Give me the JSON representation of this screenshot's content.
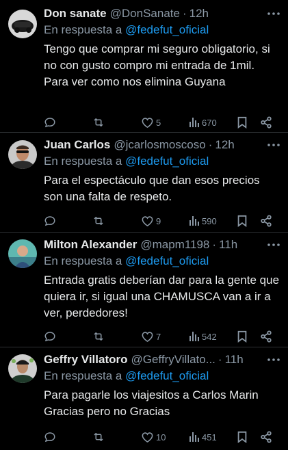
{
  "tweets": [
    {
      "name": "Don sanate",
      "handle": "@DonSanate",
      "separator": "·",
      "time": "12h",
      "reply_prefix": "En respuesta a",
      "reply_to": "@fedefut_oficial",
      "text": "Tengo que comprar mi seguro obligatorio, si no con gusto compro mi entrada de 1mil.\nPara ver como nos elimina Guyana",
      "likes": "5",
      "views": "670"
    },
    {
      "name": "Juan Carlos",
      "handle": "@jcarlosmoscoso",
      "separator": "·",
      "time": "12h",
      "reply_prefix": "En respuesta a",
      "reply_to": "@fedefut_oficial",
      "text": "Para el espectáculo que dan esos precios son una falta de respeto.",
      "likes": "9",
      "views": "590"
    },
    {
      "name": "Milton Alexander",
      "handle": "@mapm1198",
      "separator": "·",
      "time": "11h",
      "reply_prefix": "En respuesta a",
      "reply_to": "@fedefut_oficial",
      "text": "Entrada gratis deberían dar para la gente que quiera ir, si igual una CHAMUSCA van a ir a ver, perdedores!",
      "likes": "7",
      "views": "542"
    },
    {
      "name": "Geffry Villatoro",
      "handle": "@GeffryVillato...",
      "separator": "·",
      "time": "11h",
      "reply_prefix": "En respuesta a",
      "reply_to": "@fedefut_oficial",
      "text": "Para pagarle los viajesitos a Carlos Marin Gracias pero no Gracias",
      "likes": "10",
      "views": "451"
    }
  ],
  "icons": {
    "reply": "reply-icon",
    "retweet": "retweet-icon",
    "like": "heart-icon",
    "views": "views-icon",
    "bookmark": "bookmark-icon",
    "share": "share-icon",
    "more": "more-options-icon"
  },
  "colors": {
    "background": "#000000",
    "primary_text": "#e7e9ea",
    "secondary_text": "#8b98a5",
    "link": "#1d9bf0",
    "divider": "#2f3336"
  }
}
